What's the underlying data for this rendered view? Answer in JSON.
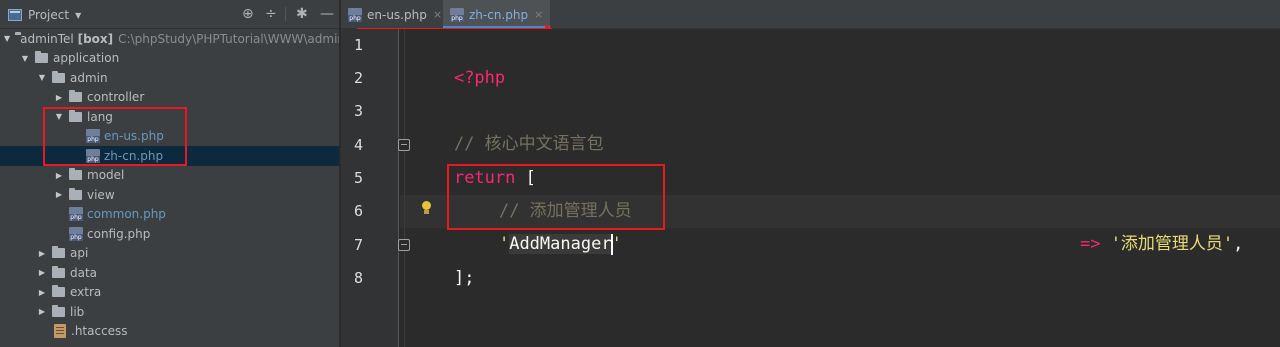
{
  "project_panel": {
    "title": "Project",
    "toolbar_icons": [
      "target-icon",
      "collapse-icon",
      "gear-icon",
      "minimize-icon"
    ]
  },
  "tree": {
    "root_name": "adminTel",
    "root_tag": "[box]",
    "root_path": "C:\\phpStudy\\PHPTutorial\\WWW\\admin",
    "items": [
      {
        "label": "application"
      },
      {
        "label": "admin"
      },
      {
        "label": "controller"
      },
      {
        "label": "lang"
      },
      {
        "label": "en-us.php"
      },
      {
        "label": "zh-cn.php"
      },
      {
        "label": "model"
      },
      {
        "label": "view"
      },
      {
        "label": "common.php"
      },
      {
        "label": "config.php"
      },
      {
        "label": "api"
      },
      {
        "label": "data"
      },
      {
        "label": "extra"
      },
      {
        "label": "lib"
      },
      {
        "label": ".htaccess"
      }
    ]
  },
  "tabs": [
    {
      "label": "en-us.php",
      "close": "×"
    },
    {
      "label": "zh-cn.php",
      "close": "×"
    }
  ],
  "editor": {
    "line_numbers": [
      "1",
      "2",
      "3",
      "4",
      "5",
      "6",
      "7",
      "8"
    ],
    "line1": "<?php",
    "line3": "// 核心中文语言包",
    "line4_kw": "return",
    "line4_rest": " [",
    "line5": "// 添加管理人员",
    "line6_quote_open": "'",
    "line6_key_a": "AddManager",
    "line6_quote_close": "'",
    "line6_arrow": "=>",
    "line6_value": "'添加管理人员'",
    "line6_comma": ",",
    "line7": "];"
  },
  "colors": {
    "annotation_red": "#e8191f",
    "selection_blue": "#0d293e",
    "keyword_pink": "#f92672",
    "string_yellow": "#e6db74",
    "comment_gray": "#75715e"
  }
}
